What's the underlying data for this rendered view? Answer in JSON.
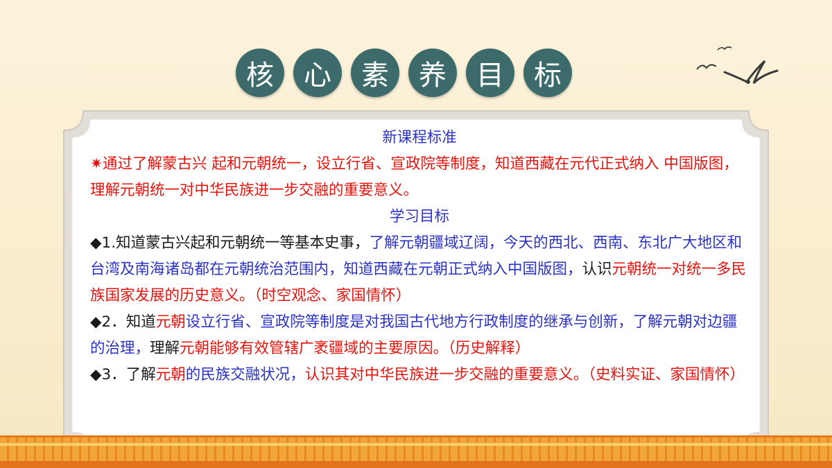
{
  "title_chars": [
    "核",
    "心",
    "素",
    "养",
    "目",
    "标"
  ],
  "section1": {
    "heading": "新课程标准",
    "bullet": "✷",
    "text_red": "通过了解蒙古兴 起和元朝统一，设立行省、宣政院等制度，知道西藏在元代正式纳入 中国版图，理解元朝统一对中华民族进一步交融的重要意义。"
  },
  "section2": {
    "heading": "学习目标",
    "items": [
      {
        "bullet": "◆",
        "segments": [
          {
            "color": "black",
            "text": "1.知道蒙古兴起和元朝统一等基本史事，"
          },
          {
            "color": "blue",
            "text": "了解元朝疆域辽阔，今天的西北、西南、东北广大地区和台湾及南海诸岛都在元朝统治范围内，知道西藏在元朝正式纳入中国版图，"
          },
          {
            "color": "black",
            "text": "认识"
          },
          {
            "color": "red",
            "text": "元朝统一对统一多民族国家发展的历史意义。（时空观念、家国情怀）"
          }
        ]
      },
      {
        "bullet": "◆",
        "segments": [
          {
            "color": "black",
            "text": "2．知道"
          },
          {
            "color": "red",
            "text": "元朝"
          },
          {
            "color": "blue",
            "text": "设立行省、宣政院等制度是对我国古代地方行政制度的继承与创新，了解元朝对边疆的治理，"
          },
          {
            "color": "black",
            "text": "理解"
          },
          {
            "color": "red",
            "text": "元朝能够有效管辖广袤疆域的主要原因。（历史解释）"
          }
        ]
      },
      {
        "bullet": "◆",
        "segments": [
          {
            "color": "black",
            "text": "3．了解"
          },
          {
            "color": "red",
            "text": "元朝"
          },
          {
            "color": "blue",
            "text": "的民族交融状况，"
          },
          {
            "color": "red",
            "text": "认识其对中华民族进一步交融的重要意义。（史料实证、家国情怀）"
          }
        ]
      }
    ]
  },
  "colors": {
    "title_circle": "#3d6b6b",
    "red": "#e6140f",
    "blue": "#2c33c4",
    "frame": "#e2ddd7"
  }
}
